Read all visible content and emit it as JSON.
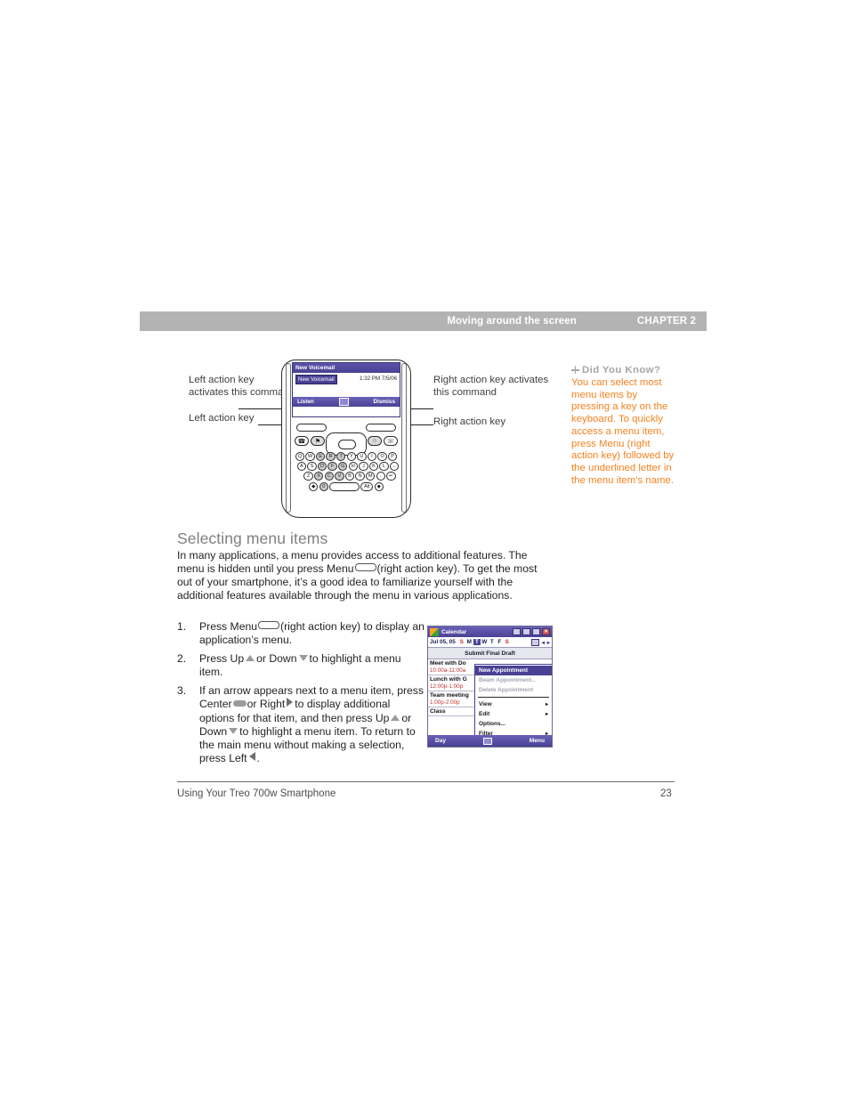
{
  "header": {
    "title": "Moving around the screen",
    "chapter": "CHAPTER 2"
  },
  "callouts": {
    "left_activates": "Left action key activates this command",
    "left_key": "Left action key",
    "right_activates": "Right action key activates this command",
    "right_key": "Right action key"
  },
  "phone_screen": {
    "title": "New Voicemail",
    "item": "New Voicemail",
    "time": "1:32 PM  7/5/06",
    "left_button": "Listen",
    "right_button": "Dismiss"
  },
  "keyboard": {
    "row1": [
      "Q",
      "W",
      "E",
      "R",
      "T",
      "Y",
      "U",
      "I",
      "O",
      "P"
    ],
    "row1_sup": [
      "@",
      "+",
      "1",
      "2",
      "3",
      "",
      "",
      "",
      "",
      ""
    ],
    "row2": [
      "A",
      "S",
      "D",
      "F",
      "G",
      "H",
      "J",
      "K",
      "L",
      "←"
    ],
    "row2_sup": [
      "A",
      "",
      "4",
      "5",
      "6",
      "",
      "",
      "",
      "",
      ""
    ],
    "row3": [
      "Z",
      "X",
      "C",
      "V",
      "B",
      "N",
      "M",
      ".",
      "↵"
    ],
    "row3_sup": [
      "*",
      "7",
      "8",
      "9",
      "",
      "",
      "",
      "",
      ""
    ],
    "row4": [
      "♦",
      "0",
      "",
      "Alt",
      "♦"
    ]
  },
  "section": {
    "heading": "Selecting menu items",
    "paragraph_1": "In many applications, a menu provides access to additional features. The menu is hidden until you press Menu",
    "paragraph_2": "(right action key). To get the most out of your smartphone, it’s a good idea to familiarize yourself with the additional features available through the menu in various applications."
  },
  "steps": [
    {
      "num": "1.",
      "part_a": "Press Menu",
      "part_b": "(right action key) to display an application’s menu."
    },
    {
      "num": "2.",
      "part_a": "Press Up",
      "part_b": "or Down",
      "part_c": "to highlight a menu item."
    },
    {
      "num": "3.",
      "part_a": "If an arrow appears next to a menu item, press Center",
      "part_b": "or Right",
      "part_c": "to display additional options for that item, and then press Up",
      "part_d": "or Down",
      "part_e": "to highlight a menu item. To return to the main menu without making a selection, press Left",
      "part_f": "."
    }
  ],
  "did_you_know": {
    "heading": "Did You Know?",
    "body": "You can select most menu items by pressing a key on the keyboard. To quickly access a menu item, press Menu (right action key) followed by the underlined letter in the menu item’s name.",
    "accent_color": "#f58220",
    "heading_color": "#a6a6a6"
  },
  "calendar": {
    "app_title": "Calendar",
    "date": "Jul 05, 05",
    "days_of_week": [
      "S",
      "M",
      "T",
      "W",
      "T",
      "F",
      "S"
    ],
    "selected_day_index": 2,
    "subject": "Submit Final Draft",
    "appointments": [
      {
        "title": "Meet with Do",
        "hours": "10:00a-11:00a"
      },
      {
        "title": "Lunch with G",
        "hours": "12:00p-1:00p"
      },
      {
        "title": "Team meeting",
        "hours": "1:00p-2:00p"
      },
      {
        "title": "Class",
        "hours": ""
      }
    ],
    "menu_items": [
      {
        "label": "New Appointment",
        "state": "selected",
        "arrow": ""
      },
      {
        "label": "Beam Appointment...",
        "state": "disabled",
        "arrow": ""
      },
      {
        "label": "Delete Appointment",
        "state": "disabled",
        "arrow": ""
      },
      {
        "label": "View",
        "state": "normal",
        "arrow": "▸"
      },
      {
        "label": "Edit",
        "state": "normal",
        "arrow": "▸"
      },
      {
        "label": "Options...",
        "state": "normal",
        "arrow": ""
      },
      {
        "label": "Filter",
        "state": "normal",
        "arrow": "▸"
      }
    ],
    "soft_left": "Day",
    "soft_right": "Menu"
  },
  "footer": {
    "left": "Using Your Treo 700w Smartphone",
    "page": "23"
  }
}
